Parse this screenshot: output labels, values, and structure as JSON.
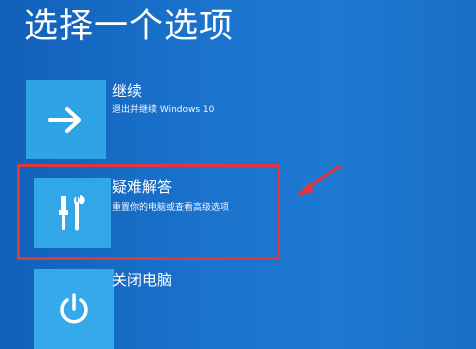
{
  "screen": {
    "title": "选择一个选项"
  },
  "options": [
    {
      "id": "continue",
      "label": "继续",
      "description": "退出并继续 Windows 10",
      "icon": "arrow-right-icon"
    },
    {
      "id": "troubleshoot",
      "label": "疑难解答",
      "description": "重置你的电脑或查看高级选项",
      "icon": "tools-icon"
    },
    {
      "id": "shutdown",
      "label": "关闭电脑",
      "description": "",
      "icon": "power-icon"
    }
  ],
  "annotation": {
    "highlight_color": "#e2363d",
    "highlighted_option": "troubleshoot"
  },
  "colors": {
    "background": "#1a72cc",
    "tile": "#2ea4e6",
    "text": "#ffffff"
  }
}
